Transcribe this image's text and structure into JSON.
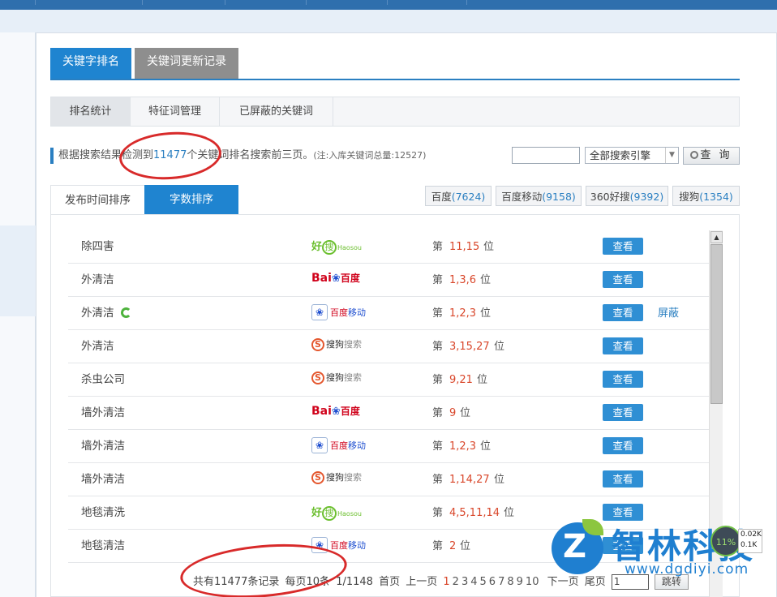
{
  "main_tabs": [
    {
      "label": "关键字排名",
      "active": true
    },
    {
      "label": "关键词更新记录",
      "active": false
    }
  ],
  "sub_tabs": [
    "排名统计",
    "特征词管理",
    "已屏蔽的关键词"
  ],
  "info": {
    "prefix": "根据搜索结果检测到",
    "count": "11477",
    "suffix": "个关键词排名搜索前三页。",
    "note": "(注:入库关键词总量:12527)"
  },
  "search": {
    "value": "",
    "engine_selected": "全部搜索引擎",
    "query_label": "查 询"
  },
  "sort_tabs": [
    {
      "label": "发布时间排序",
      "active": false
    },
    {
      "label": "字数排序",
      "active": true
    }
  ],
  "engine_tabs": [
    {
      "name": "百度",
      "count": "(7624)"
    },
    {
      "name": "百度移动",
      "count": "(9158)"
    },
    {
      "name": "360好搜",
      "count": "(9392)"
    },
    {
      "name": "搜狗",
      "count": "(1354)"
    }
  ],
  "rows": [
    {
      "keyword": "除四害",
      "engine": "haosou",
      "rank": "11,15",
      "view": "查看"
    },
    {
      "keyword": "外清洁",
      "engine": "baidu",
      "rank": "1,3,6",
      "view": "查看"
    },
    {
      "keyword": "外清洁",
      "engine": "baidu-mobile",
      "rank": "1,2,3",
      "view": "查看",
      "block": "屏蔽",
      "refresh": true
    },
    {
      "keyword": "外清洁",
      "engine": "sogou",
      "rank": "3,15,27",
      "view": "查看"
    },
    {
      "keyword": "杀虫公司",
      "engine": "sogou",
      "rank": "9,21",
      "view": "查看"
    },
    {
      "keyword": "墙外清洁",
      "engine": "baidu",
      "rank": "9",
      "view": "查看"
    },
    {
      "keyword": "墙外清洁",
      "engine": "baidu-mobile",
      "rank": "1,2,3",
      "view": "查看"
    },
    {
      "keyword": "墙外清洁",
      "engine": "sogou",
      "rank": "1,14,27",
      "view": "查看"
    },
    {
      "keyword": "地毯清洗",
      "engine": "haosou",
      "rank": "4,5,11,14",
      "view": "查看"
    },
    {
      "keyword": "地毯清洁",
      "engine": "baidu-mobile",
      "rank": "2",
      "view": "查看"
    }
  ],
  "rank_prefix": "第",
  "rank_suffix": "位",
  "engine_logos": {
    "haosou": {
      "a": "好",
      "b": "搜",
      "c": "Haosou"
    },
    "baidu": {
      "a": "Bai",
      "b": "百度"
    },
    "baidu-mobile": {
      "a": "百度移动"
    },
    "sogou": {
      "a": "S",
      "b": "搜狗搜索"
    }
  },
  "pager": {
    "total": "共有11477条记录",
    "per_page": "每页10条",
    "pages": "1/1148",
    "first": "首页",
    "prev": "上一页",
    "numbers": [
      "1",
      "2",
      "3",
      "4",
      "5",
      "6",
      "7",
      "8",
      "9",
      "10"
    ],
    "current": "1",
    "next": "下一页",
    "last": "尾页",
    "jump_value": "1",
    "jump_label": "跳转"
  },
  "watermark": {
    "title": "智林科技",
    "url": "www.dgdiyi.com",
    "badge": "11%",
    "speed_up": "0.02K",
    "speed_down": "0.1K"
  },
  "colors": {
    "accent": "#2a7fc1",
    "active_tab": "#1f84d0",
    "rank": "#d9472b",
    "annotation": "#d82a2a"
  }
}
